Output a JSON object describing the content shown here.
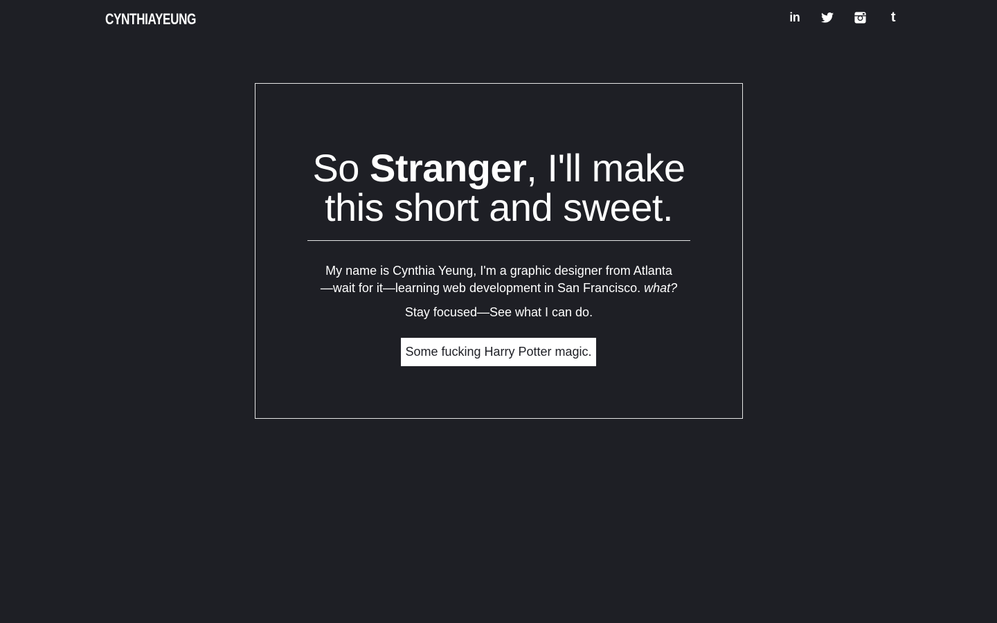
{
  "header": {
    "logo": "CYNTHIAYEUNG",
    "social": [
      {
        "icon": "linkedin-icon",
        "glyph": "in"
      },
      {
        "icon": "twitter-icon"
      },
      {
        "icon": "instagram-icon"
      },
      {
        "icon": "tumblr-icon",
        "glyph": "t"
      }
    ]
  },
  "hero": {
    "headline_pre": "So ",
    "headline_strong": "Stranger",
    "headline_post_line1": ", I'll make",
    "headline_line2": "this short and sweet.",
    "bio_line1": "My name is Cynthia Yeung, I'm a graphic designer from Atlanta",
    "bio_line2": "—wait for it—learning web development in San Francisco. ",
    "bio_emphasis": "what?",
    "tagline": "Stay focused—See what I can do.",
    "cta_label": "Some fucking Harry Potter magic."
  },
  "colors": {
    "background": "#1e1f25",
    "text": "#ffffff",
    "border": "#e6e6e6",
    "button_bg": "#ffffff",
    "button_text": "#1e1f25"
  }
}
